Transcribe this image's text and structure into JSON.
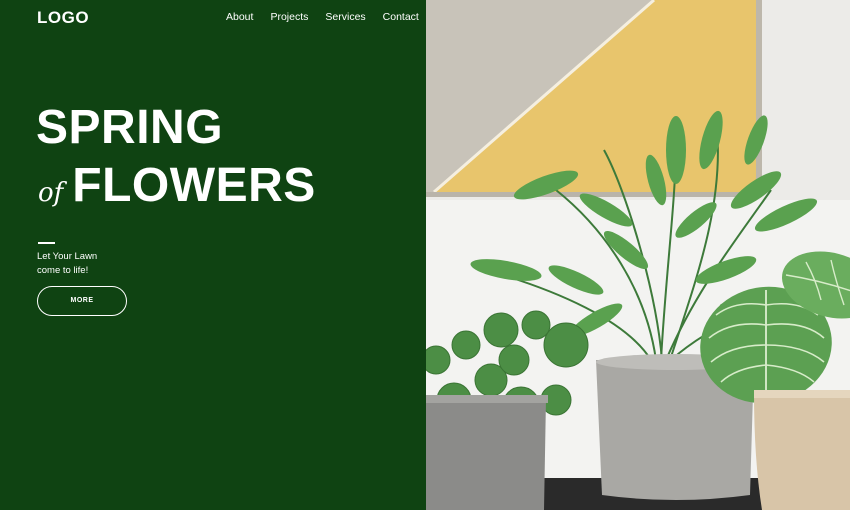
{
  "header": {
    "logo": "LOGO",
    "nav": [
      "About",
      "Projects",
      "Services",
      "Contact"
    ]
  },
  "hero": {
    "title_line1": "SPRING",
    "title_of": "of",
    "title_line2": "FLOWERS",
    "tagline_line1": "Let Your Lawn",
    "tagline_line2": "come to life!",
    "button_label": "MORE"
  },
  "colors": {
    "panel_green": "#0f4312",
    "text": "#ffffff"
  },
  "image": {
    "subject": "potted-plants-photo"
  }
}
